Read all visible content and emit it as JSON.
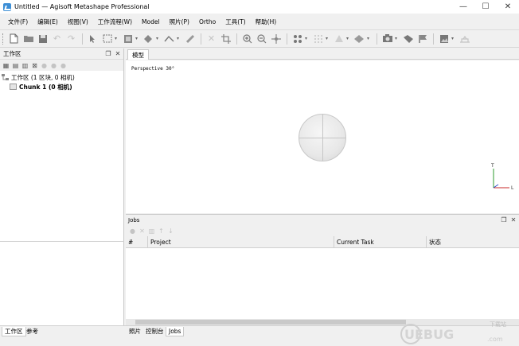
{
  "window": {
    "title": "Untitled — Agisoft Metashape Professional",
    "minimize": "—",
    "maximize": "☐",
    "close": "✕"
  },
  "menu": [
    "文件(F)",
    "编辑(E)",
    "视图(V)",
    "工作流程(W)",
    "Model",
    "照片(P)",
    "Ortho",
    "工具(T)",
    "帮助(H)"
  ],
  "workspace": {
    "title": "工作区",
    "tree_root": "工作区 (1 区块, 0 相机)",
    "chunk": "Chunk 1 (0 相机)"
  },
  "model_view": {
    "tab": "模型",
    "projection_label": "Perspective 30°",
    "axis_z": "T",
    "axis_x": "L"
  },
  "jobs": {
    "title": "Jobs",
    "columns": [
      "#",
      "Project",
      "Current Task",
      "状态"
    ]
  },
  "bottom_tabs_left": [
    "工作区",
    "参考"
  ],
  "bottom_tabs_right": [
    "照片",
    "控制台",
    "Jobs"
  ],
  "watermark": {
    "brand": "UEBUG",
    "suffix": ".com",
    "caption": "下载站"
  }
}
